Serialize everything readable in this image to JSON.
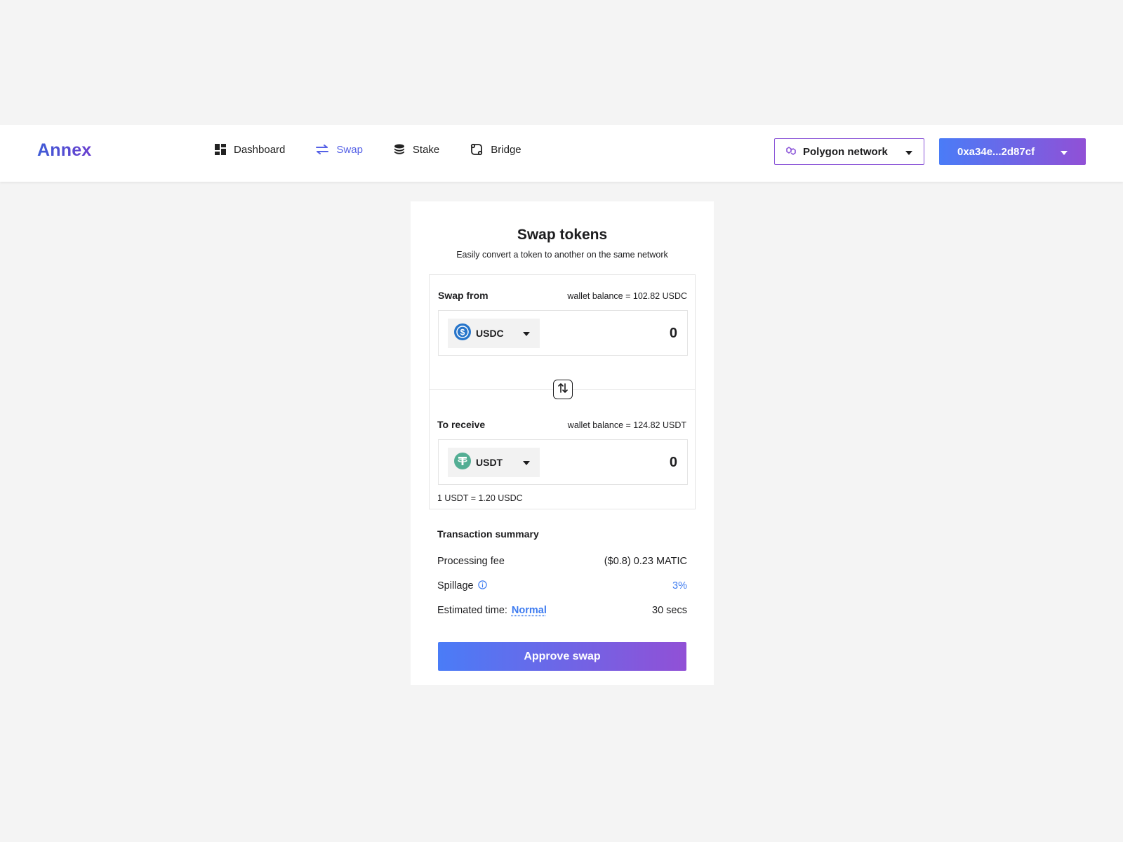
{
  "brand": {
    "name": "Annex"
  },
  "nav": [
    {
      "label": "Dashboard",
      "icon": "dashboard-icon",
      "active": false
    },
    {
      "label": "Swap",
      "icon": "swap-arrows-icon",
      "active": true
    },
    {
      "label": "Stake",
      "icon": "coins-stack-icon",
      "active": false
    },
    {
      "label": "Bridge",
      "icon": "bridge-icon",
      "active": false
    }
  ],
  "network": {
    "label": "Polygon network",
    "icon": "polygon-icon"
  },
  "wallet": {
    "address": "0xa34e...2d87cf"
  },
  "swap": {
    "title": "Swap tokens",
    "subtitle": "Easily convert a token to another on the same network",
    "from": {
      "label": "Swap from",
      "balance": "wallet balance = 102.82 USDC",
      "token": "USDC",
      "amount": "0"
    },
    "to": {
      "label": "To receive",
      "balance": "wallet balance = 124.82 USDT",
      "token": "USDT",
      "amount": "0"
    },
    "rate": "1 USDT = 1.20 USDC"
  },
  "summary": {
    "title": "Transaction summary",
    "processing_fee_label": "Processing fee",
    "processing_fee_value": "($0.8) 0.23 MATIC",
    "spillage_label": "Spillage",
    "spillage_value": "3%",
    "estimated_time_label": "Estimated time:",
    "estimated_time_speed": "Normal",
    "estimated_time_value": "30 secs"
  },
  "approve_label": "Approve swap",
  "colors": {
    "accent_blue": "#3d7bf0",
    "nav_active": "#5561e6",
    "gradient_start": "#4a7cf7",
    "gradient_end": "#9150d6",
    "usdc": "#2775ca",
    "usdt": "#53ae94"
  }
}
